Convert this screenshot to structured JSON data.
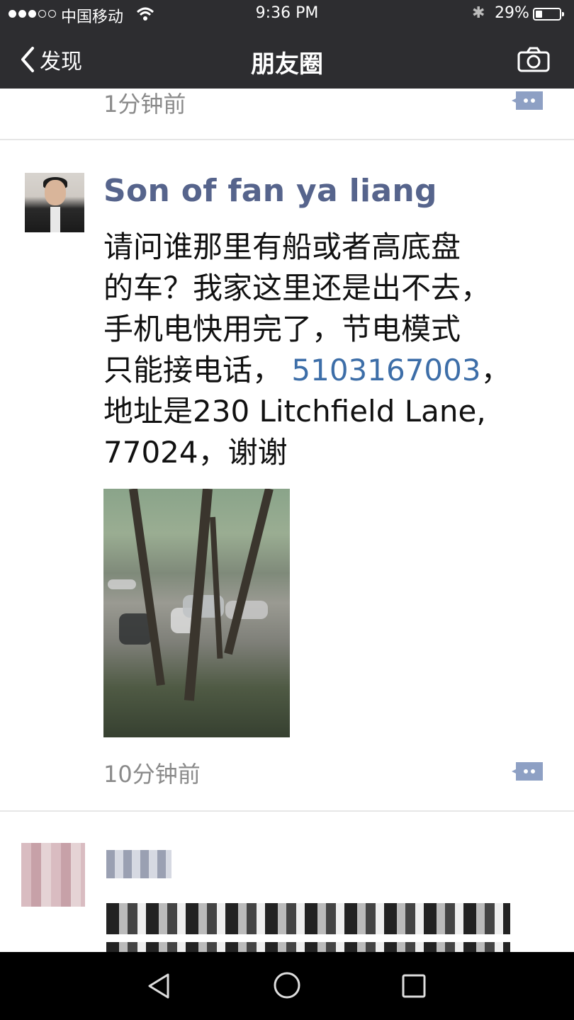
{
  "status": {
    "carrier": "中国移动",
    "time": "9:36 PM",
    "battery_percent": "29%",
    "battery_level": 0.29
  },
  "nav": {
    "back_label": "发现",
    "title": "朋友圈"
  },
  "feed": {
    "prev_post_time": "1分钟前",
    "post": {
      "author": "Son of fan ya liang",
      "text_lines": [
        "请问谁那里有船或者高底盘",
        "的车？我家这里还是出不去，",
        "手机电快用完了，节电模式"
      ],
      "line4_prefix": "只能接电话，",
      "phone": "5103167003",
      "line4_suffix": "，",
      "line5": "地址是230 Litchfield Lane,",
      "line6": "77024，谢谢",
      "time": "10分钟前"
    }
  },
  "icons": {
    "back": "chevron-left-icon",
    "camera": "camera-icon",
    "comment": "comment-icon",
    "wifi": "wifi-icon",
    "bluetooth": "bluetooth-icon"
  },
  "colors": {
    "header_bg": "#2d2d30",
    "author_name": "#56648c",
    "link": "#3d6ea8",
    "timestamp": "#8a8a8a"
  }
}
